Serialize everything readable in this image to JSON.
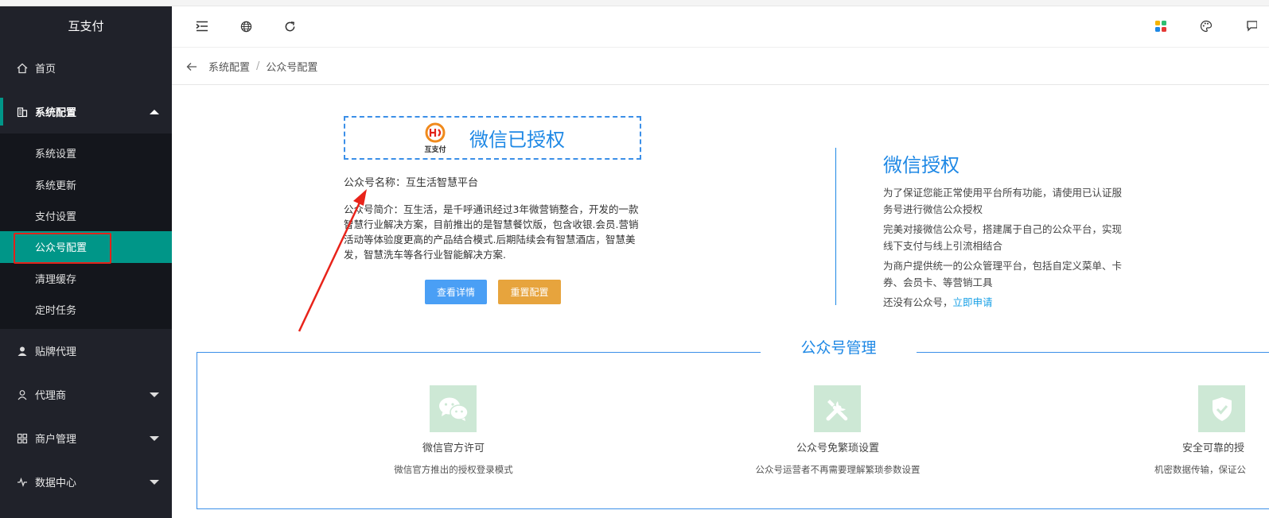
{
  "sidebar": {
    "brand": "互支付",
    "home": "首页",
    "system": "系统配置",
    "sub_items": [
      "系统设置",
      "系统更新",
      "支付设置",
      "公众号配置",
      "清理缓存",
      "定时任务"
    ],
    "oem": "贴牌代理",
    "agent": "代理商",
    "merchant": "商户管理",
    "data_center": "数据中心"
  },
  "breadcrumb": {
    "parent": "系统配置",
    "separator": "/",
    "current": "公众号配置"
  },
  "auth": {
    "logo_text": "互支付",
    "status": "微信已授权",
    "name_line": "公众号名称：互生活智慧平台",
    "desc": "公众号简介：互生活，是千呼通讯经过3年微营销整合，开发的一款智慧行业解决方案，目前推出的是智慧餐饮版，包含收银.会员.营销活动等体验度更高的产品结合模式.后期陆续会有智慧酒店，智慧美发，智慧洗车等各行业智能解决方案.",
    "btn_detail": "查看详情",
    "btn_reset": "重置配置"
  },
  "info": {
    "title": "微信授权",
    "p1": "为了保证您能正常使用平台所有功能，请使用已认证服务号进行微信公众授权",
    "p2": "完美对接微信公众号，搭建属于自己的公众平台，实现线下支付与线上引流相结合",
    "p3": "为商户提供统一的公众管理平台，包括自定义菜单、卡券、会员卡、等营销工具",
    "p4_prefix": "还没有公众号，",
    "p4_link": "立即申请"
  },
  "management": {
    "title": "公众号管理",
    "features": [
      {
        "title": "微信官方许可",
        "desc": "微信官方推出的授权登录模式",
        "icon": "wechat-icon"
      },
      {
        "title": "公众号免繁琐设置",
        "desc": "公众号运营者不再需要理解繁琐参数设置",
        "icon": "tools-icon"
      },
      {
        "title": "安全可靠的授",
        "desc": "机密数据传输，保证公",
        "icon": "shield-check-icon"
      }
    ]
  },
  "colors": {
    "accent": "#009688",
    "blue": "#1e88e5",
    "orange": "#e7a43d",
    "sidebar": "#20222a"
  }
}
